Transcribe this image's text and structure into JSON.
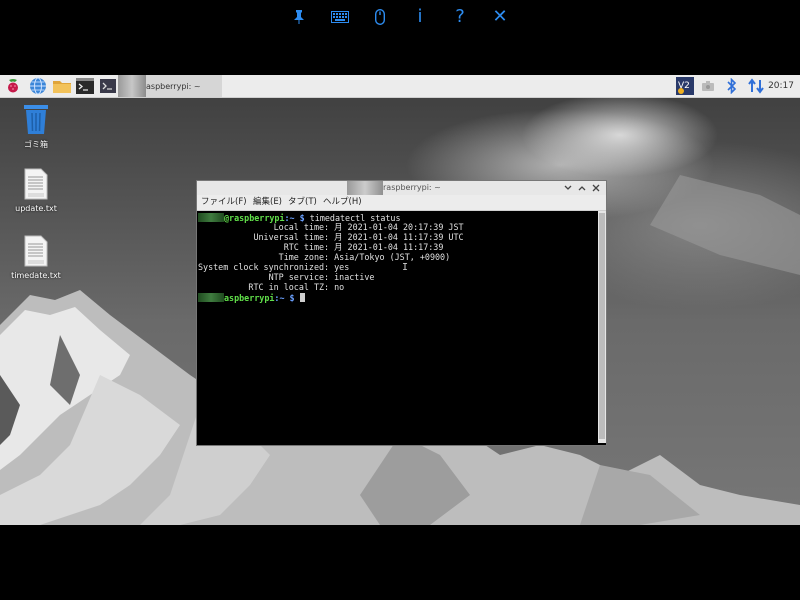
{
  "remote_toolbar": {
    "items": [
      {
        "name": "pin",
        "glyph": "📌"
      },
      {
        "name": "keyboard",
        "glyph": "⌨"
      },
      {
        "name": "mouse",
        "glyph": ""
      },
      {
        "name": "info",
        "glyph": "i"
      },
      {
        "name": "help",
        "glyph": "?"
      },
      {
        "name": "close",
        "glyph": "✕"
      }
    ]
  },
  "taskbar": {
    "task_label": "aspberrypi: ~",
    "clock": "20:17"
  },
  "desktop": {
    "icons": [
      {
        "label": "ゴミ箱"
      },
      {
        "label": "update.txt"
      },
      {
        "label": "timedate.txt"
      }
    ]
  },
  "terminal": {
    "title_suffix": "raspberrypi: ~",
    "menu": [
      "ファイル(F)",
      "編集(E)",
      "タブ(T)",
      "ヘルプ(H)"
    ],
    "prompt_host": "@raspberrypi",
    "prompt_host2": "aspberrypi",
    "prompt_path": ":~ $",
    "command": " timedatectl status",
    "lines": [
      "               Local time: 月 2021-01-04 20:17:39 JST",
      "           Universal time: 月 2021-01-04 11:17:39 UTC",
      "                 RTC time: 月 2021-01-04 11:17:39",
      "                Time zone: Asia/Tokyo (JST, +0900)",
      "System clock synchronized: yes",
      "              NTP service: inactive",
      "          RTC in local TZ: no"
    ]
  }
}
